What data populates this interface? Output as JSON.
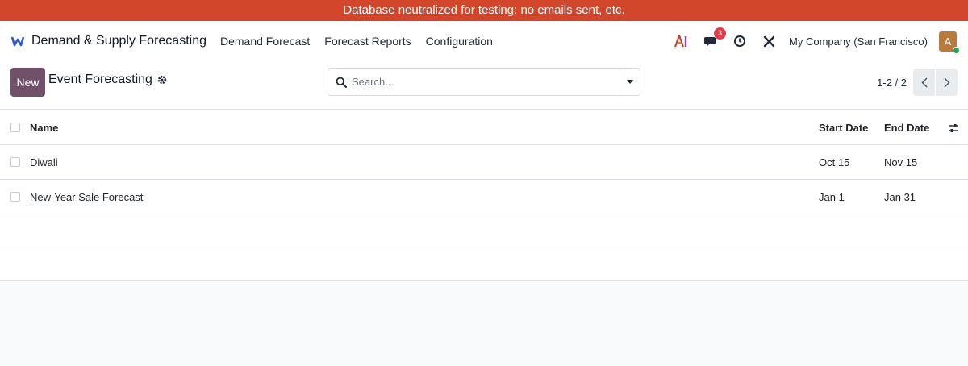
{
  "banner": {
    "text": "Database neutralized for testing: no emails sent, etc."
  },
  "navbar": {
    "app_name": "Demand & Supply Forecasting",
    "menu": [
      {
        "label": "Demand Forecast"
      },
      {
        "label": "Forecast Reports"
      },
      {
        "label": "Configuration"
      }
    ],
    "messages_badge": "3",
    "company": "My Company (San Francisco)",
    "avatar_letter": "A"
  },
  "control_panel": {
    "new_label": "New",
    "title": "Event Forecasting",
    "search_placeholder": "Search...",
    "pager": "1-2 / 2"
  },
  "list": {
    "columns": {
      "name": "Name",
      "start": "Start Date",
      "end": "End Date"
    },
    "rows": [
      {
        "name": "Diwali",
        "start": "Oct 15",
        "end": "Nov 15"
      },
      {
        "name": "New-Year Sale Forecast",
        "start": "Jan 1",
        "end": "Jan 31"
      }
    ]
  },
  "colors": {
    "banner": "#d2472c",
    "primary": "#71506a",
    "badge": "#e43a4a",
    "presence": "#22a35a"
  },
  "icons": [
    "app-logo-icon",
    "ai-icon",
    "chat-icon",
    "clock-icon",
    "tools-icon",
    "gear-icon",
    "search-icon",
    "caret-down-icon",
    "chevron-left-icon",
    "chevron-right-icon",
    "column-options-icon"
  ]
}
